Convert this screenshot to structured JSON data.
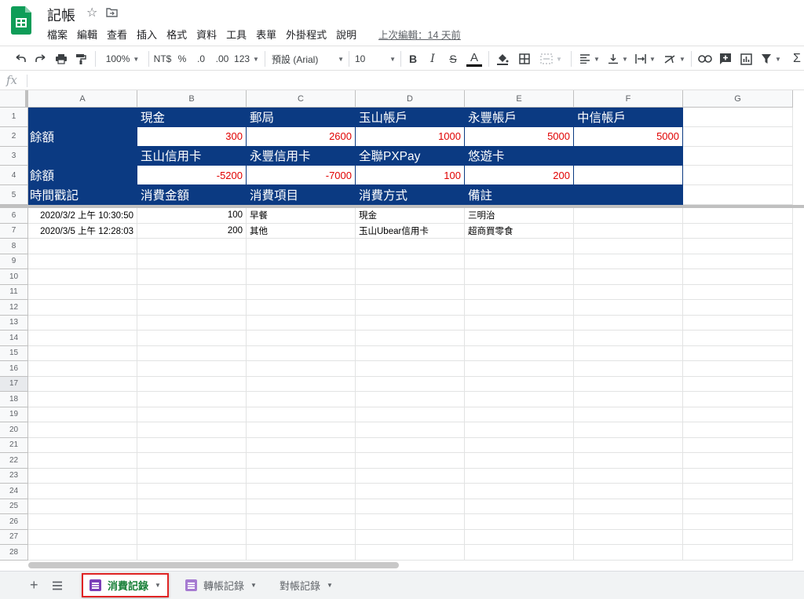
{
  "app": {
    "title": "記帳",
    "last_edit": "上次編輯：14 天前",
    "menu": [
      "檔案",
      "編輯",
      "查看",
      "插入",
      "格式",
      "資料",
      "工具",
      "表單",
      "外掛程式",
      "說明"
    ],
    "colors": {
      "header_fill": "#0b3a82",
      "value_text": "#e00000",
      "active_tab_text": "#188038",
      "highlight_border": "#e02424",
      "sheets_green": "#0f9d58"
    }
  },
  "toolbar": {
    "zoom": "100%",
    "currency": "NT$",
    "percent": "%",
    "decimal_decrease": ".0",
    "decimal_increase": ".00",
    "number_format": "123",
    "font": "預設 (Arial)",
    "font_size": "10",
    "bold": "B",
    "italic": "I",
    "strikethrough": "S",
    "text_color": "A",
    "icons": [
      "undo-icon",
      "redo-icon",
      "print-icon",
      "paint-format-icon",
      "fill-color-icon",
      "borders-icon",
      "merge-icon",
      "align-icon",
      "valign-icon",
      "wrap-icon",
      "rotate-icon",
      "link-icon",
      "comment-icon",
      "chart-icon",
      "filter-icon",
      "functions-icon"
    ]
  },
  "formula_bar": {
    "fx": "fx",
    "content": ""
  },
  "grid": {
    "columns": [
      "A",
      "B",
      "C",
      "D",
      "E",
      "F",
      "G"
    ],
    "rows": [
      "1",
      "2",
      "3",
      "4",
      "5",
      "6",
      "7",
      "8",
      "9",
      "10",
      "11",
      "12",
      "13",
      "14",
      "15",
      "16",
      "17",
      "18",
      "19",
      "20",
      "21",
      "22",
      "23",
      "24",
      "25",
      "26",
      "27",
      "28"
    ],
    "active_row": "17",
    "summary": {
      "row1": [
        "",
        "現金",
        "郵局",
        "玉山帳戶",
        "永豐帳戶",
        "中信帳戶"
      ],
      "row2": [
        "餘額",
        "300",
        "2600",
        "1000",
        "5000",
        "5000"
      ],
      "row3": [
        "",
        "玉山信用卡",
        "永豐信用卡",
        "全聯PXPay",
        "悠遊卡",
        ""
      ],
      "row4": [
        "餘額",
        "-5200",
        "-7000",
        "100",
        "200",
        ""
      ],
      "row5": [
        "時間戳記",
        "消費金額",
        "消費項目",
        "消費方式",
        "備註",
        ""
      ]
    },
    "records": [
      [
        "2020/3/2 上午 10:30:50",
        "100",
        "早餐",
        "現金",
        "三明治"
      ],
      [
        "2020/3/5 上午 12:28:03",
        "200",
        "其他",
        "玉山Ubear信用卡",
        "超商買零食"
      ]
    ]
  },
  "sheets": {
    "add_icon": "+",
    "tabs": [
      {
        "label": "消費記錄",
        "active": true
      },
      {
        "label": "轉帳記錄",
        "active": false
      },
      {
        "label": "對帳記錄",
        "active": false
      }
    ]
  }
}
